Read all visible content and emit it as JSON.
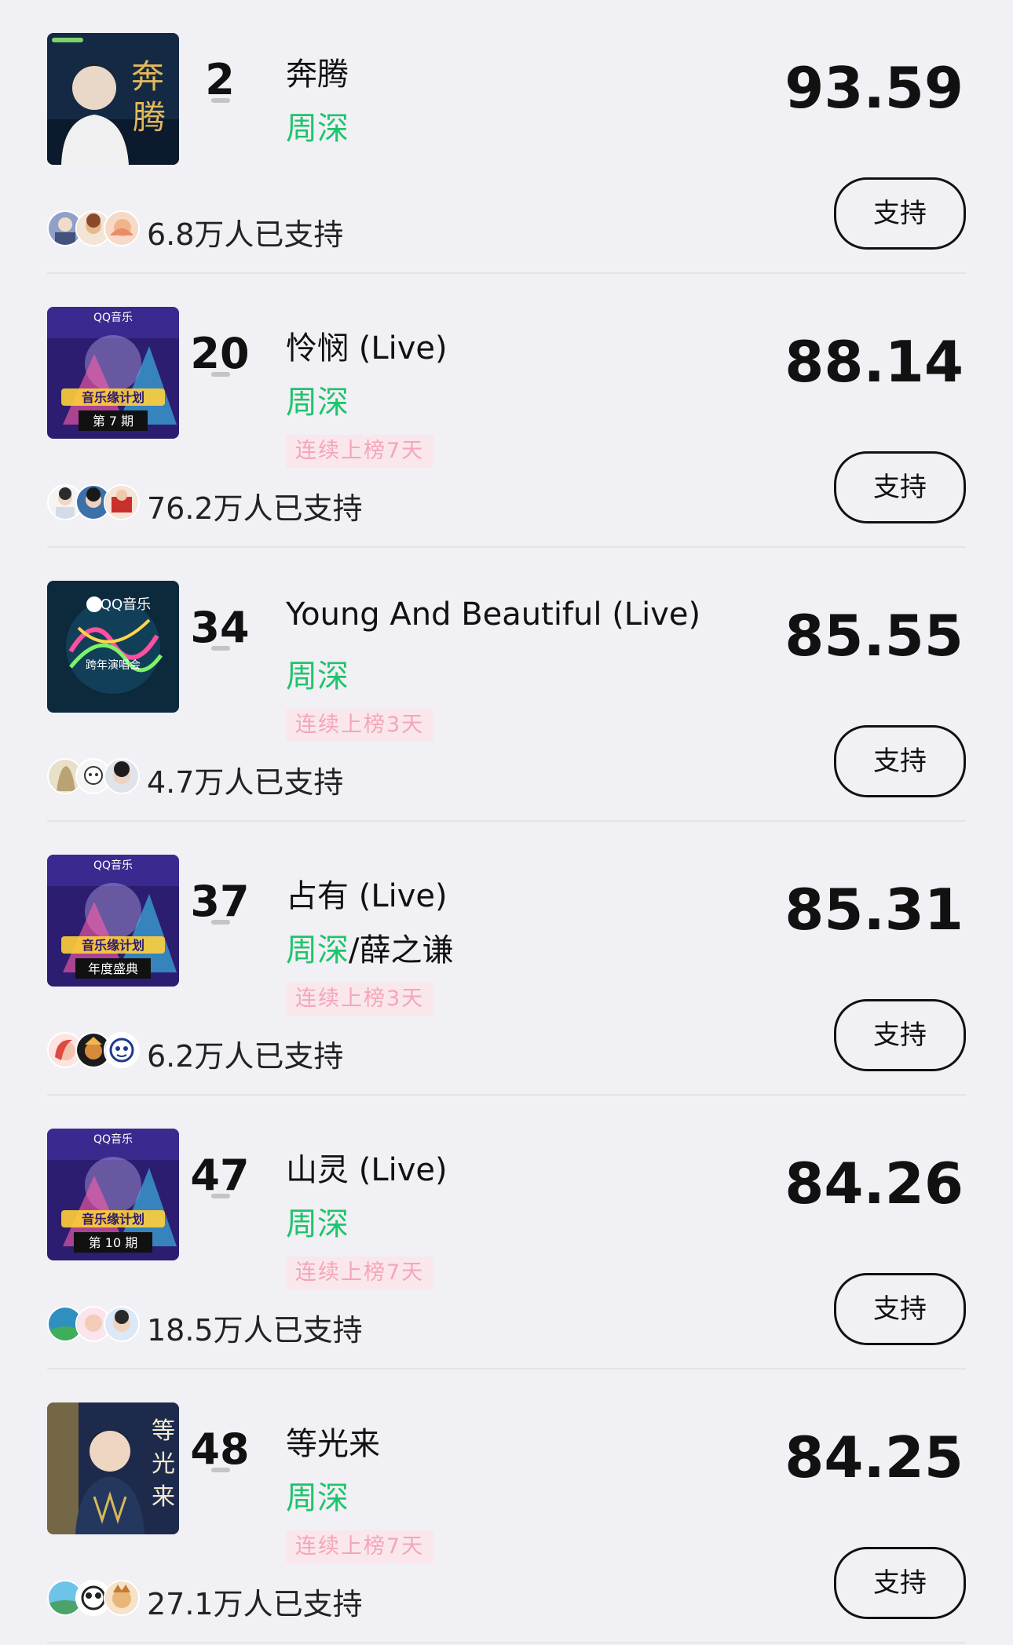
{
  "songs": [
    {
      "rank": "2",
      "title": "奔腾",
      "artist": "周深",
      "artist2": "",
      "streak": "",
      "score": "93.59",
      "supporters": "6.8万人已支持",
      "button": "支持",
      "cover": {
        "style": "gold",
        "label": "奔腾",
        "bg": "#12233a"
      }
    },
    {
      "rank": "20",
      "title": "怜悯 (Live)",
      "artist": "周深",
      "artist2": "",
      "streak": "连续上榜7天",
      "score": "88.14",
      "supporters": "76.2万人已支持",
      "button": "支持",
      "cover": {
        "style": "show",
        "label": "第 7 期",
        "bg": "#2a1c6b"
      }
    },
    {
      "rank": "34",
      "title": "Young And Beautiful (Live)",
      "artist": "周深",
      "artist2": "",
      "streak": "连续上榜3天",
      "score": "85.55",
      "supporters": "4.7万人已支持",
      "button": "支持",
      "cover": {
        "style": "neon",
        "label": "",
        "bg": "#0d2a3d"
      }
    },
    {
      "rank": "37",
      "title": "占有 (Live)",
      "artist": "周深",
      "artist2": "薛之谦",
      "streak": "连续上榜3天",
      "score": "85.31",
      "supporters": "6.2万人已支持",
      "button": "支持",
      "cover": {
        "style": "show",
        "label": "年度盛典",
        "bg": "#2a1c6b"
      }
    },
    {
      "rank": "47",
      "title": "山灵 (Live)",
      "artist": "周深",
      "artist2": "",
      "streak": "连续上榜7天",
      "score": "84.26",
      "supporters": "18.5万人已支持",
      "button": "支持",
      "cover": {
        "style": "show",
        "label": "第 10 期",
        "bg": "#2a1c6b"
      }
    },
    {
      "rank": "48",
      "title": "等光来",
      "artist": "周深",
      "artist2": "",
      "streak": "连续上榜7天",
      "score": "84.25",
      "supporters": "27.1万人已支持",
      "button": "支持",
      "cover": {
        "style": "portrait",
        "label": "等光来",
        "bg": "#1b2a4a"
      }
    }
  ],
  "separator": "/",
  "colors": {
    "artist": "#1fc46a",
    "streak_text": "#f5a5b8",
    "streak_bg": "#f9e7ec",
    "page_bg": "#f0f0f5"
  }
}
